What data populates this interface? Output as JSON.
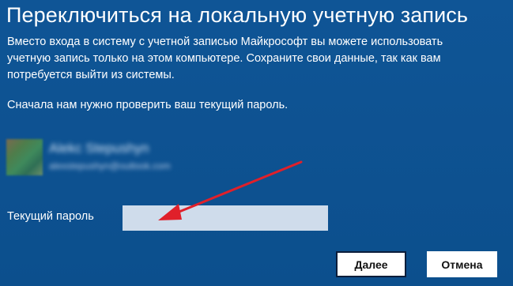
{
  "dialog": {
    "title": "Переключиться на локальную учетную запись",
    "description": "Вместо входа в систему с учетной записью Майкрософт вы можете использовать учетную запись только на этом компьютере. Сохраните свои данные, так как вам потребуется выйти из системы.",
    "check_text": "Сначала нам нужно проверить ваш текущий пароль."
  },
  "account": {
    "name": "Alekc Stepushyn",
    "email": "alexstepushyn@outlook.com"
  },
  "password": {
    "label": "Текущий пароль",
    "value": "",
    "placeholder": ""
  },
  "buttons": {
    "next_label": "Далее",
    "cancel_label": "Отмена"
  },
  "colors": {
    "background": "#0d4f8c",
    "input_background": "#cfdceb",
    "arrow": "#e0202a"
  }
}
